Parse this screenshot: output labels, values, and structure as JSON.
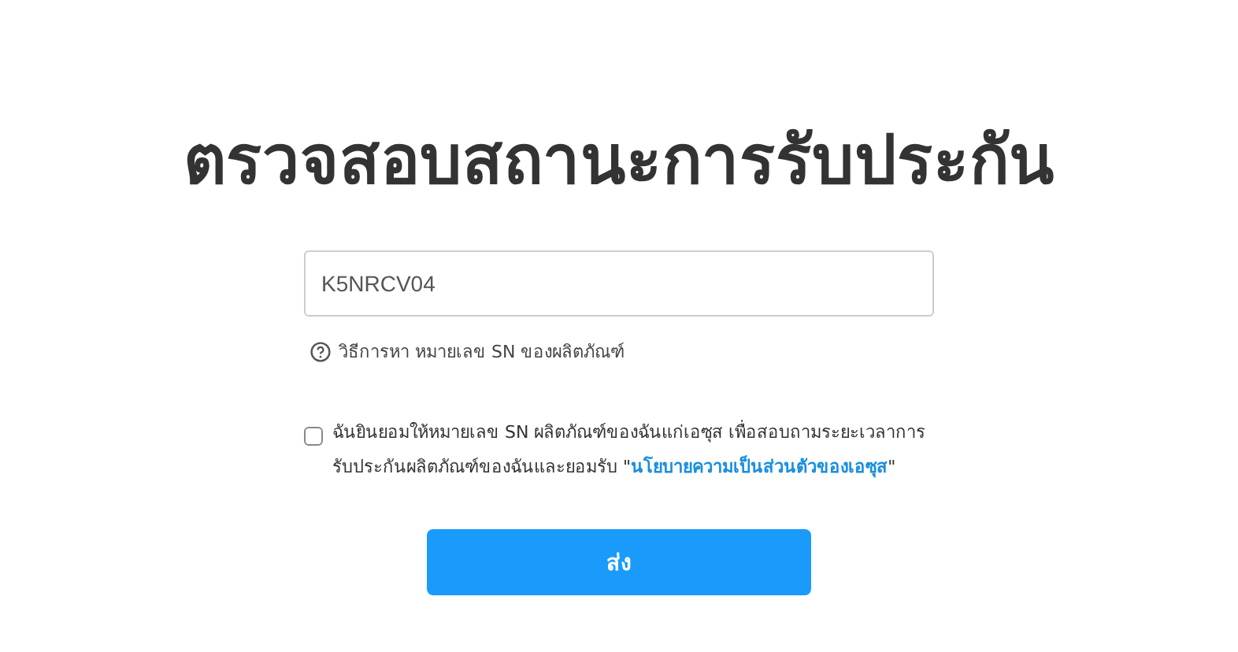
{
  "title": "ตรวจสอบสถานะการรับประกัน",
  "serial_field": {
    "value": "K5NRCV04"
  },
  "help_link": "วิธีการหา หมายเลข SN ของผลิตภัณฑ์",
  "consent": {
    "checked": false,
    "text_before": "ฉันยินยอมให้หมายเลข SN ผลิตภัณฑ์ของฉันแก่เอซุส เพื่อสอบถามระยะเวลาการรับประกันผลิตภัณฑ์ของฉันและยอมรับ \"",
    "link": "นโยบายความเป็นส่วนตัวของเอซุส",
    "text_after": "\""
  },
  "submit_button": "ส่ง"
}
